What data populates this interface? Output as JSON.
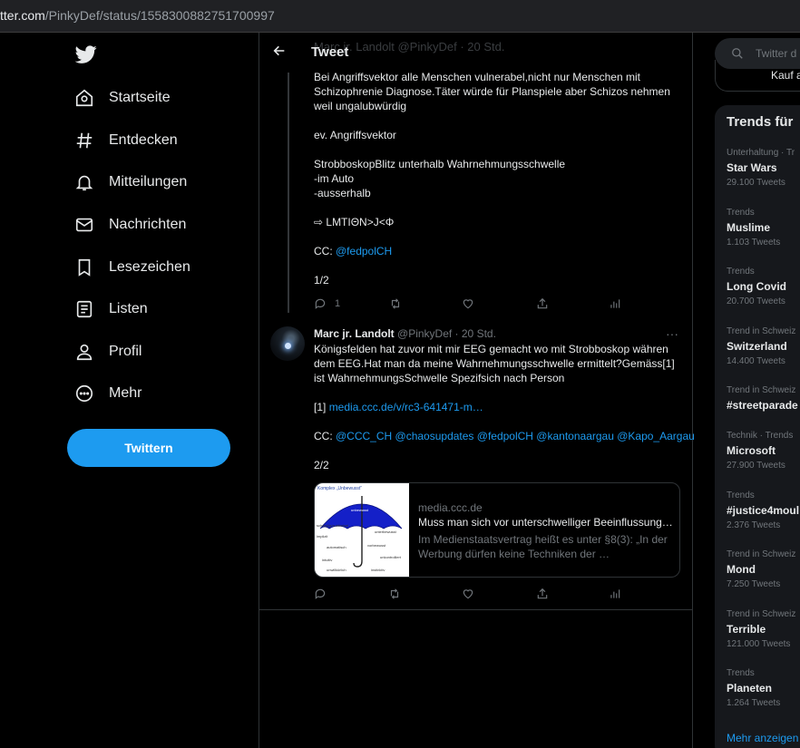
{
  "browser": {
    "url_host": "tter.com",
    "url_path": "/PinkyDef/status/1558300882751700997"
  },
  "nav": {
    "items": [
      {
        "label": "Startseite",
        "icon": "home-icon"
      },
      {
        "label": "Entdecken",
        "icon": "hashtag-icon"
      },
      {
        "label": "Mitteilungen",
        "icon": "bell-icon"
      },
      {
        "label": "Nachrichten",
        "icon": "mail-icon"
      },
      {
        "label": "Lesezeichen",
        "icon": "bookmark-icon"
      },
      {
        "label": "Listen",
        "icon": "list-icon"
      },
      {
        "label": "Profil",
        "icon": "person-icon"
      },
      {
        "label": "Mehr",
        "icon": "more-circle-icon"
      }
    ],
    "tweet_button": "Twittern"
  },
  "header": {
    "title": "Tweet",
    "ghost_text": "Marc jr. Landolt @PinkyDef · 20 Std."
  },
  "tweet1": {
    "lines": [
      "Bei Angriffsvektor alle Menschen vulnerabel,nicht nur Menschen mit",
      "Schizophrenie Diagnose.Täter würde für Planspiele aber Schizos nehmen",
      "weil ungalubwürdig",
      "",
      "ev. Angriffsvektor",
      "",
      "StrobboskopBlitz unterhalb Wahrnehmungsschwelle",
      "-im Auto",
      "-ausserhalb",
      "",
      "⇨ LMTIΘN>J<Φ",
      ""
    ],
    "cc_prefix": "CC: ",
    "cc_link": "@fedpolCH",
    "page": "1/2",
    "reply_count": "1"
  },
  "tweet2": {
    "name": "Marc jr. Landolt",
    "meta": " @PinkyDef · 20 Std.",
    "lines": [
      "Königsfelden hat zuvor mit mir EEG gemacht wo mit Strobboskop währen",
      "dem EEG.Hat man da meine Wahrnehmungsschwelle ermittelt?Gemäss[1]",
      "ist WahrnehmungsSchwelle Spezifsich nach Person"
    ],
    "ref_prefix": "[1] ",
    "ref_link": "media.ccc.de/v/rc3-641471-m…",
    "cc_prefix": "CC: ",
    "cc_links": "@CCC_CH @chaosupdates @fedpolCH @kantonaargau @Kapo_Aargau",
    "page": "2/2",
    "card": {
      "domain": "media.ccc.de",
      "title": "Muss man sich vor unterschwelliger Beeinflussung…",
      "desc1": "Im Medienstaatsvertrag heißt es unter §8(3): „In der",
      "desc2": "Werbung dürfen keine Techniken der …",
      "thumb_caption": "Komplex „Unbewusst“",
      "thumb_words": [
        "unbewusst",
        "schwellig/subliminal",
        "unterbewusst",
        "implizit",
        "automatisch",
        "vorbewusst",
        "intuitiv",
        "unkontrolliert",
        "unwillkürlich",
        "instinktiv"
      ]
    }
  },
  "right": {
    "search_placeholder": "Twitter d",
    "prev_button": "Kauf a",
    "trends_title": "Trends für",
    "trends": [
      {
        "context": "Unterhaltung · Tr",
        "name": "Star Wars",
        "count": "29.100 Tweets"
      },
      {
        "context": "Trends",
        "name": "Muslime",
        "count": "1.103 Tweets"
      },
      {
        "context": "Trends",
        "name": "Long Covid",
        "count": "20.700 Tweets"
      },
      {
        "context": "Trend in Schweiz",
        "name": "Switzerland",
        "count": "14.400 Tweets"
      },
      {
        "context": "Trend in Schweiz",
        "name": "#streetparade",
        "count": ""
      },
      {
        "context": "Technik · Trends",
        "name": "Microsoft",
        "count": "27.900 Tweets"
      },
      {
        "context": "Trends",
        "name": "#justice4moul",
        "count": "2.376 Tweets"
      },
      {
        "context": "Trend in Schweiz",
        "name": "Mond",
        "count": "7.250 Tweets"
      },
      {
        "context": "Trend in Schweiz",
        "name": "Terrible",
        "count": "121.000 Tweets"
      },
      {
        "context": "Trends",
        "name": "Planeten",
        "count": "1.264 Tweets"
      }
    ],
    "more_link": "Mehr anzeigen"
  },
  "colors": {
    "background": "#000000",
    "accent": "#1d9bf0",
    "text": "#e7e9ea",
    "muted": "#71767b",
    "border": "#2f3336",
    "panel": "#16181c"
  }
}
